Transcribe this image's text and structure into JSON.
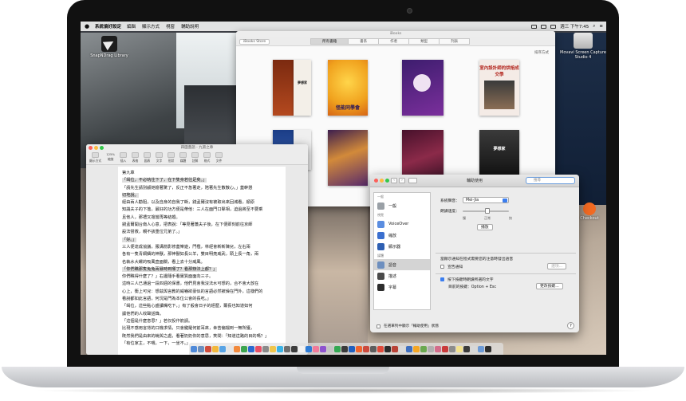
{
  "menubar": {
    "app_name": "系統偏好設定",
    "menus": [
      "編輯",
      "顯示方式",
      "視窗",
      "輔助說明"
    ],
    "clock": "週三 下午7:45"
  },
  "desktop": {
    "snap_label": "SnapNDrag Library",
    "disk_label": "Movavi Screen Capture Studio 4",
    "misc_label": "Checkout"
  },
  "ibooks": {
    "window_title": "iBooks",
    "store_button": "iBooks Store",
    "tabs": [
      "所有書籍",
      "書系",
      "作者",
      "類型",
      "列表"
    ],
    "active_tab": 0,
    "sort_label": "排序方式",
    "books": [
      {
        "title": "夢想家"
      },
      {
        "title": "怪能同學會"
      },
      {
        "title": ""
      },
      {
        "title": "室內設計師的烘焙成交學"
      },
      {
        "title": ""
      },
      {
        "title": ""
      },
      {
        "title": ""
      },
      {
        "title": "夢想家"
      }
    ]
  },
  "pages": {
    "window_title": "四圍蓋語 - 九第之章",
    "toolbar": [
      "顯示方式",
      "縮放",
      "插入",
      "表格",
      "圖表",
      "文字",
      "形狀",
      "媒體",
      "註解",
      "格式",
      "文件"
    ],
    "zoom": "125%",
    "lines": [
      {
        "text": "第九章",
        "hl": false
      },
      {
        "text": "「竭位，不必吶住下了，在下隻身若往足矣。」",
        "hl": true
      },
      {
        "text": "「請先生請別顧她擔著驚了，反正不急著走，陪著先生散散心。」蓋幹懇",
        "hl": false
      },
      {
        "text": "切地說。",
        "hl": true
      },
      {
        "text": "經由兩人勸阻，以及自身的自我了斷，錢孟爾沒有被取出來回城看，順原",
        "hl": false
      },
      {
        "text": "知識夫子的下落，最好的功方便是帶他：三人在面門口擊相，迫過將至不要乘",
        "hl": false
      },
      {
        "text": "且他人，那禮又擔當再等結婚。",
        "hl": false
      },
      {
        "text": "錢孟爾開台南人心意，把表說：「等見著蕭夫子後，在下便即刻前往京師",
        "hl": false
      },
      {
        "text": "設法營救，親不該重位兄弟了。」",
        "hl": false
      },
      {
        "text": "「好。」",
        "hl": true
      },
      {
        "text": "三人便達成協議，服溝箭影修蓋樂遊，門檻，林經會新新陳兒，左右兩",
        "hl": false
      },
      {
        "text": "各有一隻青銅鑄的神獸，那神獸如長公羊，雙目明亮威武，頭上長一角，兩",
        "hl": false
      },
      {
        "text": "名執水大螺的吸風壺面關，看上去十分威風。",
        "hl": false
      },
      {
        "text": "「你們瞧那隻兔兔兩暴時到哪了？看那辦法上都？」",
        "hl": true
      },
      {
        "text": "你們瞧得什麼了？」右邊隨手看實質面面向三子。",
        "hl": false
      },
      {
        "text": "這時三人已通過一段四週的保書，他們見會我沒法水可想的，合不會大放在",
        "hl": false
      },
      {
        "text": "心上，衝上可兒：想茲與言教的威嚇欲豪似的言語必然被燥在門外，這樣們的",
        "hl": false
      },
      {
        "text": "看說都如此言語，何況是門為本位公會的長吃。」",
        "hl": false
      },
      {
        "text": "「竭位，這些點心盛讀嘴吃下，」有了般會日子的經歷，爾長也知道如何",
        "hl": false
      },
      {
        "text": "讓他們的人收聲話鋒。",
        "hl": false
      },
      {
        "text": "「這個是什麼意思？」若仅投作箭請。",
        "hl": false
      },
      {
        "text": "比現不感用言背的口機求情，只會鍵羅何前耳來，幸苦偏檔到一無所獲，",
        "hl": false
      },
      {
        "text": "既然我們是由來的蛻與之處，看著奶奶你的意思，笑問：「知道這路的目的嗎？」",
        "hl": false
      },
      {
        "text": "「有位家主，不喂，一下，一坐不。」",
        "hl": false
      }
    ]
  },
  "accessibility": {
    "window_title": "輔助使用",
    "search_placeholder": "搜尋",
    "sidebar": [
      {
        "section": "一般",
        "label": "一般",
        "color": "#9aa0a6"
      },
      {
        "section": "視覺",
        "label": "VoiceOver",
        "color": "#5a8de0"
      },
      {
        "section": "",
        "label": "縮放",
        "color": "#3a6fcf"
      },
      {
        "section": "",
        "label": "顯示器",
        "color": "#2e5fb2"
      },
      {
        "section": "媒體",
        "label": "語音",
        "color": "#6d8fbf"
      },
      {
        "section": "",
        "label": "描述",
        "color": "#4a4a4a"
      },
      {
        "section": "",
        "label": "字幕",
        "color": "#2d2d2d"
      }
    ],
    "selected_index": 4,
    "system_voice_label": "系統聲音：",
    "system_voice_value": "Mei-Jia",
    "speaking_rate_label": "朗讀速度：",
    "rate_ticks": [
      "慢",
      "正常",
      "快"
    ],
    "play_button": "播放",
    "announce_text": "當顯示通知在程式需要您的注意時發出語音",
    "announce_checkbox": "宣告通知",
    "options_button": "選項...",
    "speak_selected_checkbox": "按下按鍵時朗讀所選的文字",
    "current_key_label": "目前的按鍵：Option + Esc",
    "change_key_button": "更改按鍵...",
    "footer_checkbox": "在選單列中顯示「輔助使用」狀態",
    "help": "?"
  },
  "dock": {
    "app_colors": [
      "#4f8ad9",
      "#6b8fbf",
      "#d14c3b",
      "#f2b83d",
      "#59a4e5",
      "#e6e6e6",
      "#f28a3d",
      "#3da54f",
      "#2c6ad0",
      "#e94f64",
      "#8a8a8a",
      "#f0c64b",
      "#3ab3e6",
      "#6e6e6e",
      "#3d3d3d",
      "#f2f2f2",
      "#2e7cd6",
      "#f27a9a",
      "#8e53cf",
      "#c4c4c4",
      "#34a853",
      "#3a3a3a",
      "#1f5fbf",
      "#f0642e",
      "#cc4a3c",
      "#5d5d5d",
      "#e04a3a",
      "#2b2b2b",
      "#b94236",
      "#dadada",
      "#3f6fbf",
      "#f5a623",
      "#6aa84f",
      "#b0b0b0",
      "#d46c8a",
      "#c93a3a",
      "#8c8c8c",
      "#f3e28e",
      "#3b3b3b",
      "#d8d8d8",
      "#6c9ad6",
      "#2d2d2d"
    ]
  }
}
